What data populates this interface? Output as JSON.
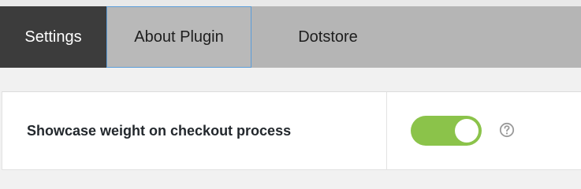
{
  "tabs": [
    {
      "label": "Settings",
      "state": "active"
    },
    {
      "label": "About Plugin",
      "state": "focused"
    },
    {
      "label": "Dotstore",
      "state": "normal"
    }
  ],
  "settings": {
    "rows": [
      {
        "label": "Showcase weight on checkout process",
        "toggle_on": true,
        "help_icon": "question-circle-icon"
      }
    ]
  },
  "colors": {
    "tab_bar": "#b5b5b5",
    "active_tab": "#3c3c3c",
    "focus_outline": "#5b9dd9",
    "toggle_on": "#8bc34a",
    "page_background": "#f1f1f1"
  }
}
